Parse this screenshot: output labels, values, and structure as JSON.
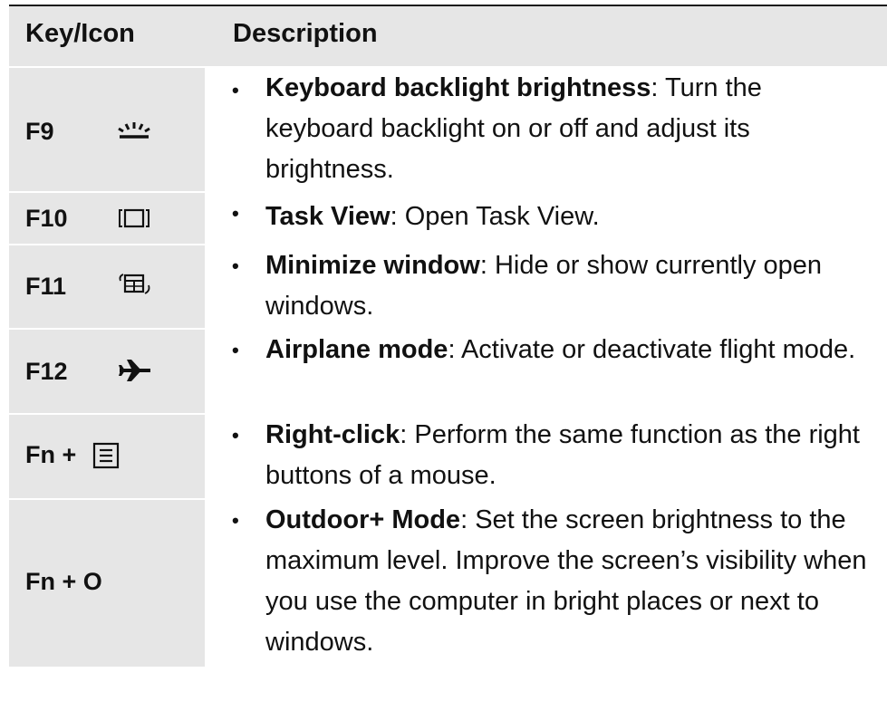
{
  "header": {
    "key_col": "Key/Icon",
    "desc_col": "Description"
  },
  "rows": [
    {
      "key": "F9",
      "icon": "keyboard-backlight-icon",
      "bullet": "•",
      "term": "Keyboard backlight brightness",
      "desc": ": Turn the keyboard backlight on or off and adjust its brightness."
    },
    {
      "key": "F10",
      "icon": "task-view-icon",
      "bullet": "•",
      "term": "Task View",
      "desc": ": Open Task View."
    },
    {
      "key": "F11",
      "icon": "minimize-window-icon",
      "bullet": "•",
      "term": "Minimize window",
      "desc": ": Hide or show currently open windows."
    },
    {
      "key": "F12",
      "icon": "airplane-icon",
      "bullet": "•",
      "term": "Airplane mode",
      "desc": ": Activate or deactivate flight mode."
    },
    {
      "key": "Fn +",
      "icon": "menu-key-icon",
      "bullet": "•",
      "term": "Right-click",
      "desc": ": Perform the same function as the right buttons of a mouse."
    },
    {
      "key": "Fn + O",
      "icon": "",
      "bullet": "•",
      "term": "Outdoor+ Mode",
      "desc": ": Set the screen brightness to the maximum level. Improve the screen’s visibility when you use the computer in bright places or next to windows."
    }
  ]
}
